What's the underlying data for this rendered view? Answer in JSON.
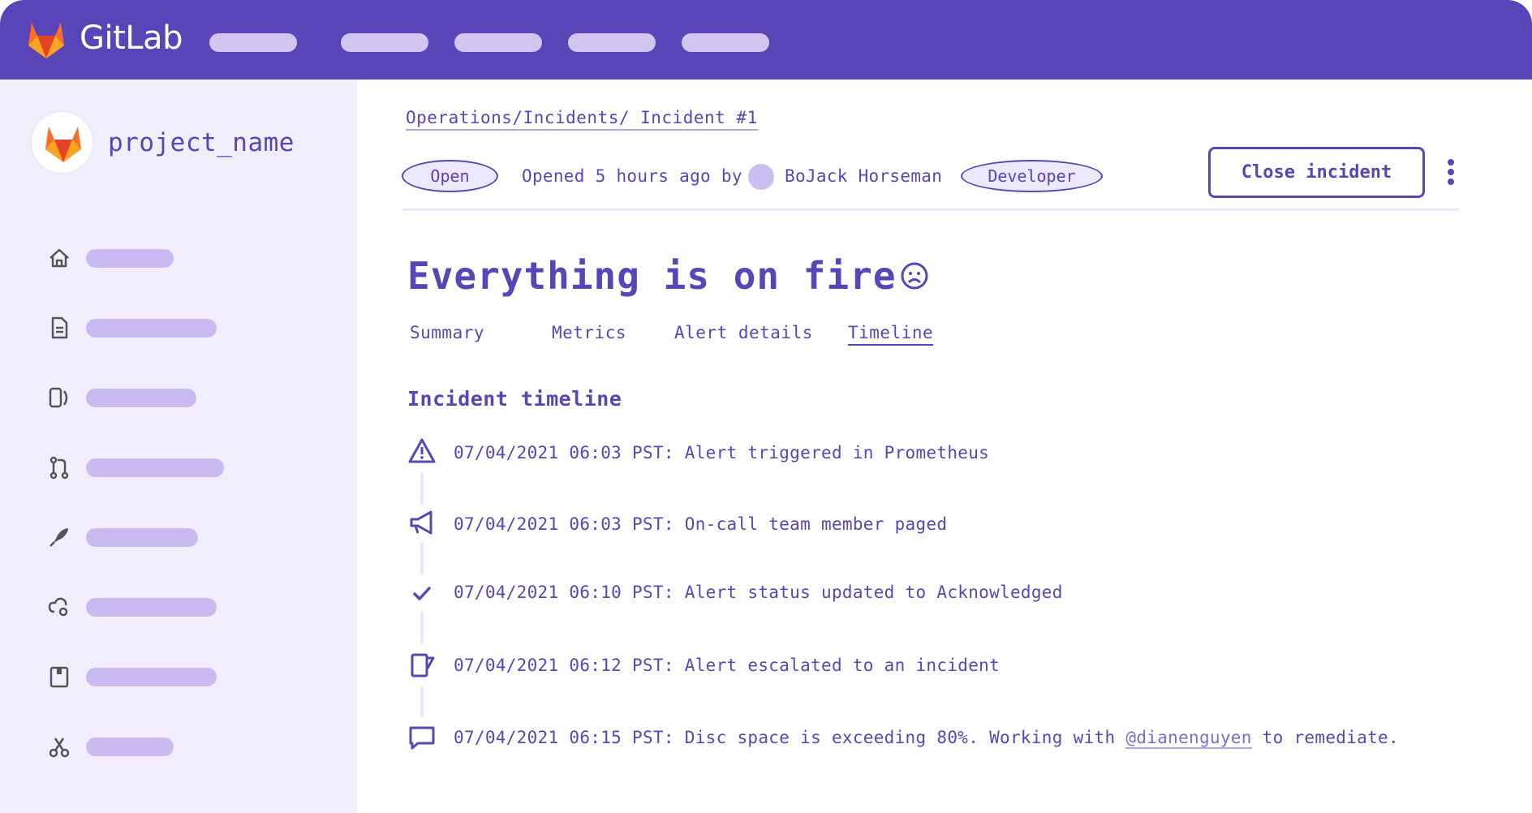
{
  "app": {
    "brand": "GitLab"
  },
  "project": {
    "name": "project_name"
  },
  "breadcrumb": "Operations/Incidents/ Incident #1",
  "status": {
    "state": "Open",
    "opened_text": "Opened 5 hours ago by",
    "user": "BoJack Horseman",
    "role": "Developer"
  },
  "actions": {
    "close_label": "Close incident"
  },
  "incident": {
    "title": "Everything is on fire"
  },
  "tabs": [
    {
      "label": "Summary"
    },
    {
      "label": "Metrics"
    },
    {
      "label": "Alert details"
    },
    {
      "label": "Timeline"
    }
  ],
  "timeline": {
    "title": "Incident timeline",
    "events": [
      {
        "icon": "warning-icon",
        "text": "07/04/2021 06:03 PST: Alert triggered in Prometheus"
      },
      {
        "icon": "megaphone-icon",
        "text": "07/04/2021 06:03 PST: On-call team member paged"
      },
      {
        "icon": "check-icon",
        "text": "07/04/2021 06:10 PST: Alert status updated to Acknowledged"
      },
      {
        "icon": "escalate-icon",
        "text": "07/04/2021 06:12 PST: Alert escalated to an incident"
      },
      {
        "icon": "comment-icon",
        "text_before": "07/04/2021 06:15 PST: Disc space is exceeding 80%. Working with",
        "mention": "@dianenguyen",
        "text_after": "to remediate."
      }
    ]
  },
  "sidebar_icons": [
    "home-icon",
    "document-icon",
    "issues-icon",
    "merge-request-icon",
    "rocket-icon",
    "cloud-settings-icon",
    "package-icon",
    "snippets-icon"
  ],
  "colors": {
    "primary": "#5a45b8",
    "sidebar_bg": "#f2eefd",
    "pill": "#c9baf1",
    "nav_pill": "#d1c5f2"
  }
}
